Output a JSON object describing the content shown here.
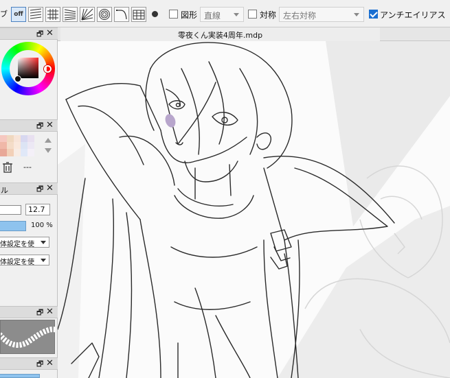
{
  "toolbar": {
    "cut_label": "ブ",
    "snap_off_label": "off",
    "shape_label": "図形",
    "shape_value": "直線",
    "symmetry_label": "対称",
    "symmetry_value": "左右対称",
    "antialias_label": "アンチエイリアス（全体"
  },
  "document": {
    "tab_title": "零夜くん実装4周年.mdp"
  },
  "panels": {
    "brush_panel_title": "ル",
    "brush_size": "12.7",
    "opacity": "100 %",
    "blend_dropdown_1": "体設定を使",
    "blend_dropdown_2": "体設定を使",
    "layer_name_dash": "---"
  },
  "colors": {
    "accent": "#1a6fd1",
    "current_color": "#c43a3a",
    "slider_fill": "#8ec3ee"
  },
  "swatches": [
    "#f6c8c0",
    "#f0d8c0",
    "#f8e4d8",
    "#d8d8f0",
    "#e8e0f0",
    "#f0b8a8",
    "#f4dcc8",
    "#fae8dc",
    "#dce4f4",
    "#ece8f4",
    "#e8a898",
    "#f2d0b8",
    "#f8ece4",
    "#e0e8f8",
    "#f4f0f8"
  ]
}
